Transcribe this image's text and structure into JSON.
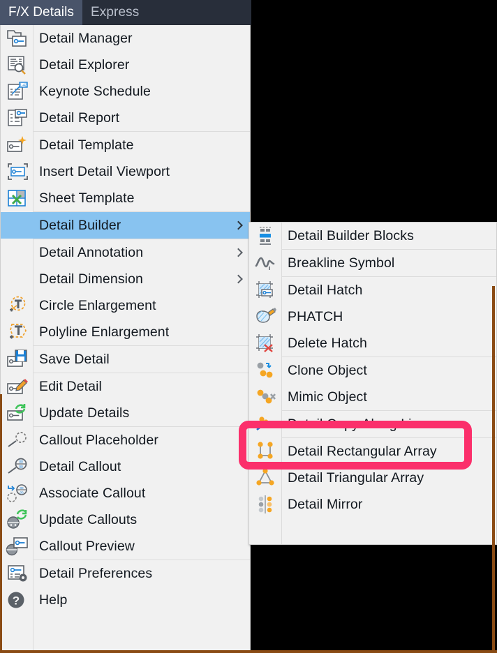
{
  "window": {
    "background_color": "#000000",
    "drawing_border_color": "#8a4b14"
  },
  "tabbar": {
    "background_color": "#282e3a",
    "active_color": "#49546a",
    "tabs": [
      {
        "label": "F/X Details",
        "active": true
      },
      {
        "label": "Express",
        "active": false
      }
    ]
  },
  "main_menu": {
    "highlight_color": "#88c3f0",
    "items": [
      {
        "label": "Detail Manager",
        "icon": "detail-manager-icon",
        "submenu": false,
        "selected": false,
        "separator_after": false
      },
      {
        "label": "Detail Explorer",
        "icon": "detail-explorer-icon",
        "submenu": false,
        "selected": false,
        "separator_after": false
      },
      {
        "label": "Keynote Schedule",
        "icon": "keynote-schedule-icon",
        "submenu": false,
        "selected": false,
        "separator_after": false
      },
      {
        "label": "Detail Report",
        "icon": "detail-report-icon",
        "submenu": false,
        "selected": false,
        "separator_after": true
      },
      {
        "label": "Detail Template",
        "icon": "detail-template-icon",
        "submenu": false,
        "selected": false,
        "separator_after": false
      },
      {
        "label": "Insert Detail Viewport",
        "icon": "insert-detail-viewport-icon",
        "submenu": false,
        "selected": false,
        "separator_after": false
      },
      {
        "label": "Sheet Template",
        "icon": "sheet-template-icon",
        "submenu": false,
        "selected": false,
        "separator_after": true
      },
      {
        "label": "Detail Builder",
        "icon": "none",
        "submenu": true,
        "selected": true,
        "separator_after": true
      },
      {
        "label": "Detail Annotation",
        "icon": "none",
        "submenu": true,
        "selected": false,
        "separator_after": false
      },
      {
        "label": "Detail Dimension",
        "icon": "none",
        "submenu": true,
        "selected": false,
        "separator_after": false
      },
      {
        "label": "Circle Enlargement",
        "icon": "circle-enlargement-icon",
        "submenu": false,
        "selected": false,
        "separator_after": false
      },
      {
        "label": "Polyline Enlargement",
        "icon": "polyline-enlargement-icon",
        "submenu": false,
        "selected": false,
        "separator_after": true
      },
      {
        "label": "Save Detail",
        "icon": "save-detail-icon",
        "submenu": false,
        "selected": false,
        "separator_after": true
      },
      {
        "label": "Edit Detail",
        "icon": "edit-detail-icon",
        "submenu": false,
        "selected": false,
        "separator_after": false
      },
      {
        "label": "Update Details",
        "icon": "update-details-icon",
        "submenu": false,
        "selected": false,
        "separator_after": true
      },
      {
        "label": "Callout Placeholder",
        "icon": "callout-placeholder-icon",
        "submenu": false,
        "selected": false,
        "separator_after": false
      },
      {
        "label": "Detail Callout",
        "icon": "detail-callout-icon",
        "submenu": false,
        "selected": false,
        "separator_after": false
      },
      {
        "label": "Associate Callout",
        "icon": "associate-callout-icon",
        "submenu": false,
        "selected": false,
        "separator_after": false
      },
      {
        "label": "Update Callouts",
        "icon": "update-callouts-icon",
        "submenu": false,
        "selected": false,
        "separator_after": false
      },
      {
        "label": "Callout Preview",
        "icon": "callout-preview-icon",
        "submenu": false,
        "selected": false,
        "separator_after": true
      },
      {
        "label": "Detail Preferences",
        "icon": "detail-preferences-icon",
        "submenu": false,
        "selected": false,
        "separator_after": false
      },
      {
        "label": "Help",
        "icon": "help-icon",
        "submenu": false,
        "selected": false,
        "separator_after": false
      }
    ]
  },
  "submenu": {
    "parent": "Detail Builder",
    "items": [
      {
        "label": "Detail Builder Blocks",
        "icon": "detail-builder-blocks-icon",
        "separator_after": true,
        "highlighted": false
      },
      {
        "label": "Breakline Symbol",
        "icon": "breakline-symbol-icon",
        "separator_after": true,
        "highlighted": false
      },
      {
        "label": "Detail Hatch",
        "icon": "detail-hatch-icon",
        "separator_after": false,
        "highlighted": false
      },
      {
        "label": "PHATCH",
        "icon": "phatch-icon",
        "separator_after": false,
        "highlighted": false
      },
      {
        "label": "Delete Hatch",
        "icon": "delete-hatch-icon",
        "separator_after": true,
        "highlighted": false
      },
      {
        "label": "Clone Object",
        "icon": "clone-object-icon",
        "separator_after": false,
        "highlighted": false
      },
      {
        "label": "Mimic Object",
        "icon": "mimic-object-icon",
        "separator_after": true,
        "highlighted": false
      },
      {
        "label": "Detail Copy Along Line",
        "icon": "detail-copy-along-line-icon",
        "separator_after": true,
        "highlighted": true
      },
      {
        "label": "Detail Rectangular Array",
        "icon": "detail-rectangular-array-icon",
        "separator_after": false,
        "highlighted": false
      },
      {
        "label": "Detail Triangular Array",
        "icon": "detail-triangular-array-icon",
        "separator_after": false,
        "highlighted": false
      },
      {
        "label": "Detail Mirror",
        "icon": "detail-mirror-icon",
        "separator_after": false,
        "highlighted": false
      }
    ]
  },
  "annotation": {
    "type": "highlight-box",
    "target": "Detail Copy Along Line",
    "color": "#fb2f6b"
  }
}
